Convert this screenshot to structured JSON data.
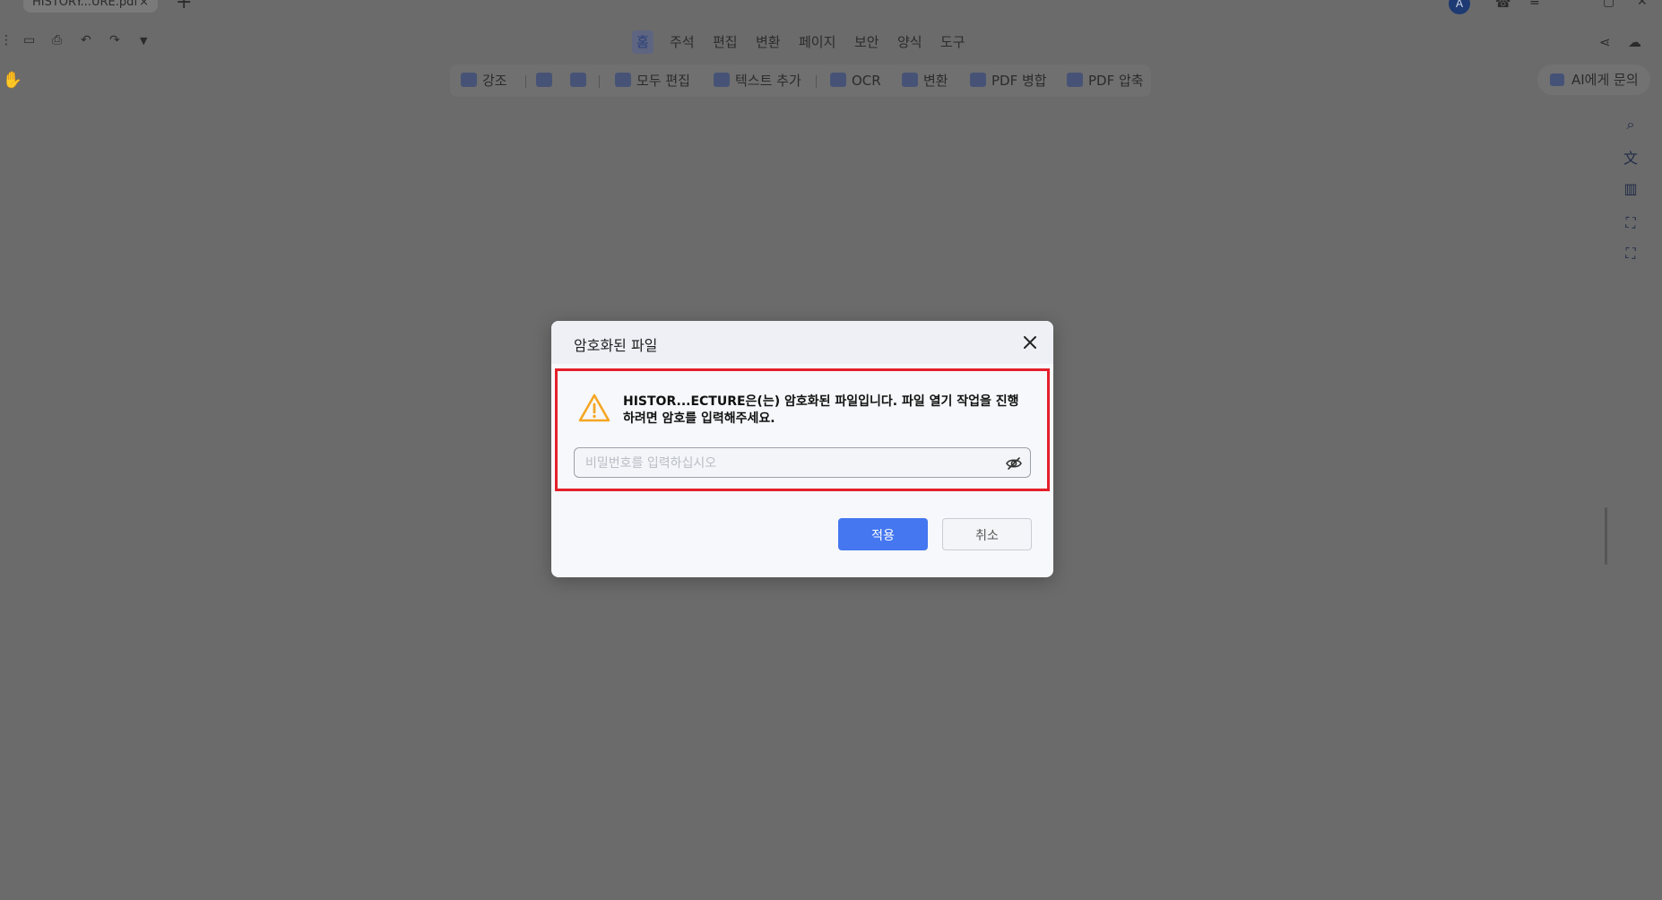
{
  "tab": {
    "title": "HISTORY...URE.pdf",
    "close": "×",
    "new_tab": "+"
  },
  "avatar_letter": "A",
  "menu": {
    "items": [
      "홈",
      "주석",
      "편집",
      "변환",
      "페이지",
      "보안",
      "양식",
      "도구"
    ],
    "active_index": 0
  },
  "toolbar": {
    "highlight": "강조",
    "edit_all": "모두 편집",
    "add_text": "텍스트 추가",
    "ocr": "OCR",
    "convert": "변환",
    "merge_pdf": "PDF 병합",
    "compress_pdf": "PDF 압축"
  },
  "ai_button": "AI에게 문의",
  "dialog": {
    "title": "암호화된 파일",
    "message": "HISTOR...ECTURE은(는) 암호화된 파일입니다. 파일 열기 작업을 진행하려면 암호를 입력해주세요.",
    "password_placeholder": "비밀번호를 입력하십시오",
    "apply": "적용",
    "cancel": "취소"
  },
  "colors": {
    "primary": "#4477f0",
    "highlight_border": "#e4202b",
    "warning": "#f5a623",
    "overlay_bg": "#6b6b6b"
  }
}
